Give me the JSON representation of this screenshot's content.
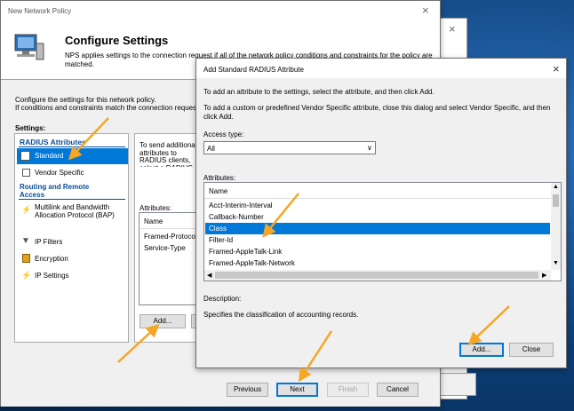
{
  "background_dialog_right": {
    "close_glyph": "×"
  },
  "network_policy": {
    "title": "New Network Policy",
    "close_glyph": "×",
    "header_title": "Configure Settings",
    "header_desc": "NPS applies settings to the connection request if all of the network policy conditions and constraints for the policy are matched.",
    "intro_line1": "Configure the settings for this network policy.",
    "intro_line2": "If conditions and constraints match the connection request and the policy grants access, settings are applied.",
    "settings_label": "Settings:",
    "tree": {
      "radius_header": "RADIUS Attributes",
      "standard": "Standard",
      "vendor_specific": "Vendor Specific",
      "routing_header": "Routing and Remote Access",
      "multilink": "Multilink and Bandwidth Allocation Protocol (BAP)",
      "ip_filters": "IP Filters",
      "encryption": "Encryption",
      "ip_settings": "IP Settings"
    },
    "right_panel": {
      "desc": "To send additional attributes to RADIUS clients, select a RADIUS Standard attribute, and then click Edit. If you do not configure an attribute, it is not sent to RADIUS clients. See your RADIUS client documentation for required attributes.",
      "attributes_label": "Attributes:",
      "col_name": "Name",
      "rows": [
        "Framed-Protocol",
        "Service-Type"
      ],
      "add_button": "Add..."
    },
    "footer": {
      "previous": "Previous",
      "next": "Next",
      "finish": "Finish",
      "cancel": "Cancel"
    }
  },
  "radius_dialog": {
    "title": "Add Standard RADIUS Attribute",
    "close_glyph": "×",
    "line1": "To add an attribute to the settings, select the attribute, and then click Add.",
    "line2": "To add a custom or predefined Vendor Specific attribute, close this dialog and select Vendor Specific, and then click Add.",
    "access_type_label": "Access type:",
    "access_type_value": "All",
    "attributes_label": "Attributes:",
    "col_name": "Name",
    "attributes": [
      "Acct-Interim-Interval",
      "Callback-Number",
      "Class",
      "Filter-Id",
      "Framed-AppleTalk-Link",
      "Framed-AppleTalk-Network"
    ],
    "selected_attribute": "Class",
    "description_label": "Description:",
    "description_text": "Specifies the classification of accounting records.",
    "add_button": "Add...",
    "close_button": "Close"
  },
  "colors": {
    "selection": "#0078d7",
    "accent_arrow": "#f5a623"
  }
}
